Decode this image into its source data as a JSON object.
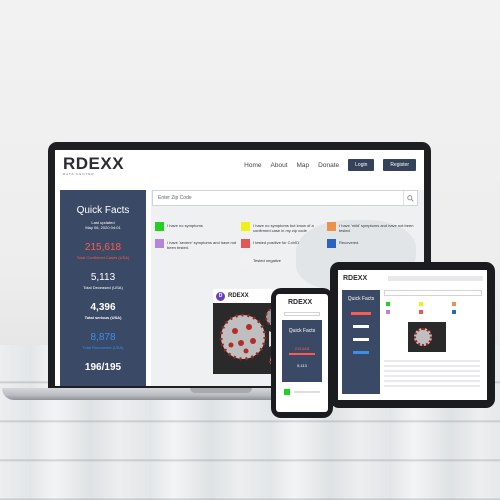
{
  "site": {
    "logo": "RDEXX",
    "logo_sub": "DATA CENTER",
    "nav": [
      "Home",
      "About",
      "Map",
      "Donate"
    ],
    "login_label": "Login",
    "register_label": "Register"
  },
  "quick_facts": {
    "title": "Quick Facts",
    "updated_line1": "Last updated",
    "updated_line2": "May 06, 2020 04:01",
    "stats": [
      {
        "value": "215,618",
        "label": "Total Confirmed Cases (USA)",
        "color": "#ff5a50"
      },
      {
        "value": "5,113",
        "label": "Total Deceased (USA)",
        "color": "#ffffff"
      },
      {
        "value": "4,396",
        "label": "Total serious (USA)",
        "color": "#ffffff"
      },
      {
        "value": "8,878",
        "label": "Total Recovered (USA)",
        "color": "#3a8fe8"
      },
      {
        "value": "196/195",
        "label": "",
        "color": "#ffffff"
      }
    ]
  },
  "search": {
    "placeholder": "Enter Zip Code",
    "icon": "search-icon"
  },
  "legend": [
    {
      "color": "#22d11f",
      "text": "I have no symptoms"
    },
    {
      "color": "#f2ee17",
      "text": "I have no symptoms but know of a confirmed case in my zip code"
    },
    {
      "color": "#e8924a",
      "text": "I have 'mild' symptoms and have not been tested"
    },
    {
      "color": "#b287d8",
      "text": "I have 'severe' symptoms and have not been tested."
    },
    {
      "color": "#e25757",
      "text": "I tested positive for CoViD"
    },
    {
      "color": "#2a64c0",
      "text": "Recovered"
    },
    {
      "color": "#eeeeee",
      "text": ""
    },
    {
      "color": "#f1f1f1",
      "text": "Tested negative"
    }
  ],
  "virus_card": {
    "badge": "D",
    "logo": "RDEXX"
  },
  "phone": {
    "logo": "RDEXX",
    "qf_title": "Quick Facts",
    "value1": "215,618",
    "value2": "5,113"
  },
  "tablet": {
    "logo": "RDEXX",
    "qf_title": "Quick Facts"
  }
}
